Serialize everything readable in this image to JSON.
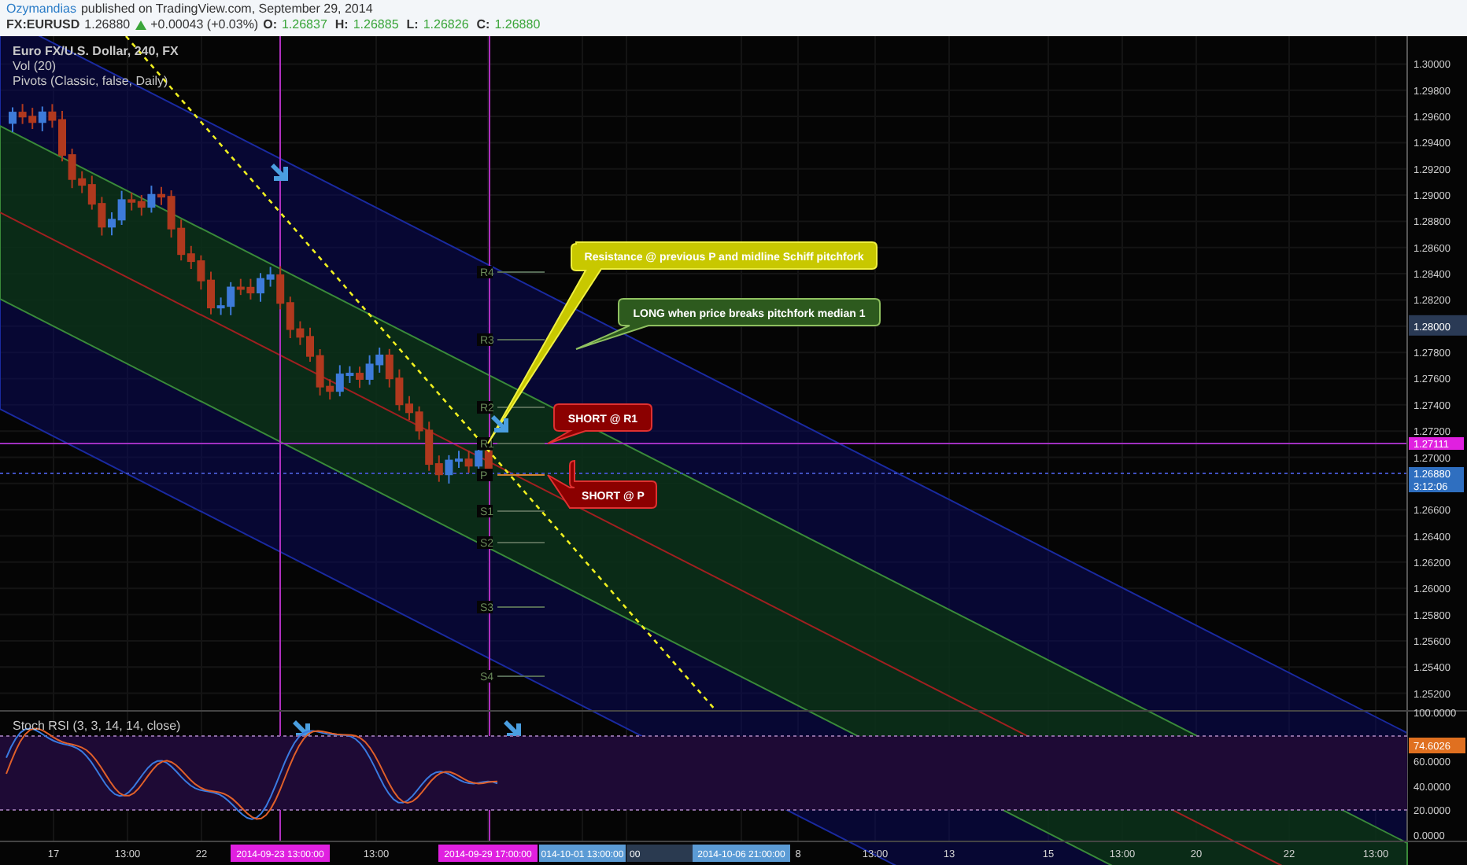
{
  "header": {
    "author": "Ozymandias",
    "published": "published on TradingView.com, September 29, 2014",
    "symbol": "FX:EURUSD",
    "price": "1.26880",
    "change": "+0.00043 (+0.03%)",
    "ohlc": [
      {
        "label": "O:",
        "value": "1.26837"
      },
      {
        "label": "H:",
        "value": "1.26885"
      },
      {
        "label": "L:",
        "value": "1.26826"
      },
      {
        "label": "C:",
        "value": "1.26880"
      }
    ]
  },
  "legend": [
    "Euro FX/U.S. Dollar, 240, FX",
    "Vol (20)",
    "Pivots (Classic, false, Daily)"
  ],
  "pivots": [
    "R4",
    "R3",
    "R2",
    "R1",
    "P",
    "S1",
    "S2",
    "S3",
    "S4"
  ],
  "callouts": [
    {
      "text": "Resistance @ previous P and midline Schiff pitchfork",
      "color": "#c8c800"
    },
    {
      "text": "LONG when price breaks pitchfork median 1",
      "color": "#2d5a1e"
    },
    {
      "text": "SHORT @ R1",
      "color": "#8b0000"
    },
    {
      "text": "SHORT @ P",
      "color": "#8b0000"
    }
  ],
  "price_axis": [
    {
      "text": "1.30000",
      "highlighted": false
    },
    {
      "text": "1.29800",
      "highlighted": false
    },
    {
      "text": "1.29600",
      "highlighted": false
    },
    {
      "text": "1.29400",
      "highlighted": false
    },
    {
      "text": "1.29200",
      "highlighted": false
    },
    {
      "text": "1.29000",
      "highlighted": false
    },
    {
      "text": "1.28800",
      "highlighted": false
    },
    {
      "text": "1.28600",
      "highlighted": false
    },
    {
      "text": "1.28400",
      "highlighted": false
    },
    {
      "text": "1.28200",
      "highlighted": false
    },
    {
      "text": "1.28000",
      "highlighted": true
    },
    {
      "text": "1.27800",
      "highlighted": false
    },
    {
      "text": "1.27600",
      "highlighted": false
    },
    {
      "text": "1.27400",
      "highlighted": false
    },
    {
      "text": "1.27200",
      "highlighted": false
    },
    {
      "text": "1.27000",
      "highlighted": false
    },
    {
      "text": "1.26600",
      "highlighted": false
    },
    {
      "text": "1.26400",
      "highlighted": false
    },
    {
      "text": "1.26200",
      "highlighted": false
    },
    {
      "text": "1.26000",
      "highlighted": false
    },
    {
      "text": "1.25800",
      "highlighted": false
    },
    {
      "text": "1.25600",
      "highlighted": false
    },
    {
      "text": "1.25400",
      "highlighted": false
    },
    {
      "text": "1.25200",
      "highlighted": false
    }
  ],
  "price_labels": [
    {
      "text": "1.27111",
      "color": "#e020e0"
    },
    {
      "text": "1.26880",
      "color": "#2f6fc0"
    },
    {
      "text": "3:12:06",
      "color": "#2f6fc0"
    }
  ],
  "stoch": {
    "title": "Stoch RSI (3, 3, 14, 14, close)",
    "ticks": [
      "100.0000",
      "60.0000",
      "40.0000",
      "20.0000",
      "0.0000"
    ],
    "value": "74.6026"
  },
  "time_axis": [
    {
      "text": "17",
      "kind": "tick"
    },
    {
      "text": "13:00",
      "kind": "tick"
    },
    {
      "text": "22",
      "kind": "tick"
    },
    {
      "text": "2014-09-23 13:00:00",
      "kind": "marker",
      "color": "#e020e0"
    },
    {
      "text": "13:00",
      "kind": "tick"
    },
    {
      "text": "2014-09-29 17:00:00",
      "kind": "marker",
      "color": "#e020e0"
    },
    {
      "text": "014-10-01 13:00:00",
      "kind": "marker",
      "color": "#5b9bd5"
    },
    {
      "text": "00",
      "kind": "marker",
      "color": "#2a3a50"
    },
    {
      "text": "2014-10-06 21:00:00",
      "kind": "marker",
      "color": "#5b9bd5"
    },
    {
      "text": "8",
      "kind": "tick"
    },
    {
      "text": "13:00",
      "kind": "tick"
    },
    {
      "text": "13",
      "kind": "tick"
    },
    {
      "text": "15",
      "kind": "tick"
    },
    {
      "text": "13:00",
      "kind": "tick"
    },
    {
      "text": "20",
      "kind": "tick"
    },
    {
      "text": "22",
      "kind": "tick"
    },
    {
      "text": "13:00",
      "kind": "tick"
    }
  ]
}
